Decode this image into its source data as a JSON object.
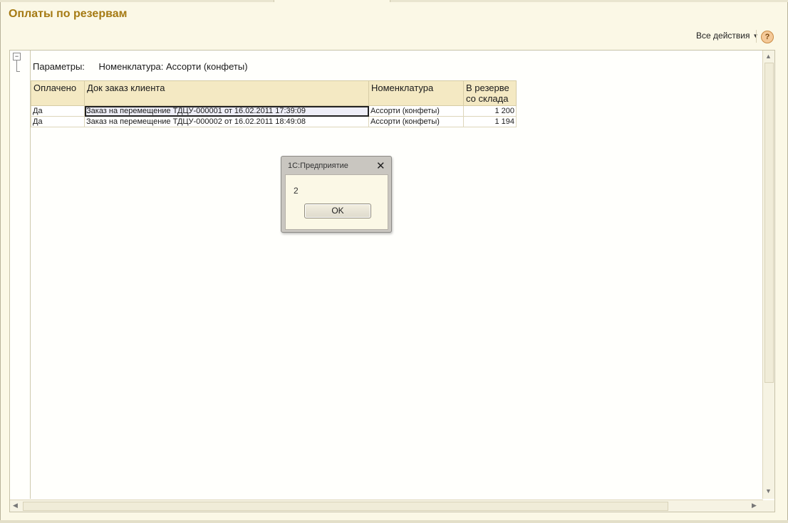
{
  "page": {
    "title": "Оплаты по резервам",
    "all_actions_label": "Все действия",
    "help_label": "?"
  },
  "report": {
    "params_label": "Параметры:",
    "params_value": "Номенклатура: Ассорти (конфеты)",
    "columns": [
      "Оплачено",
      "Док заказ клиента",
      "Номенклатура",
      "В резерве\nсо склада"
    ],
    "rows": [
      [
        "Да",
        "Заказ на перемещение ТДЦУ-000001 от 16.02.2011 17:39:09",
        "Ассорти (конфеты)",
        "1 200"
      ],
      [
        "Да",
        "Заказ на перемещение ТДЦУ-000002 от 16.02.2011 18:49:08",
        "Ассорти (конфеты)",
        "1 194"
      ]
    ]
  },
  "modal": {
    "title": "1С:Предприятие",
    "message": "2",
    "ok_label": "OK"
  }
}
